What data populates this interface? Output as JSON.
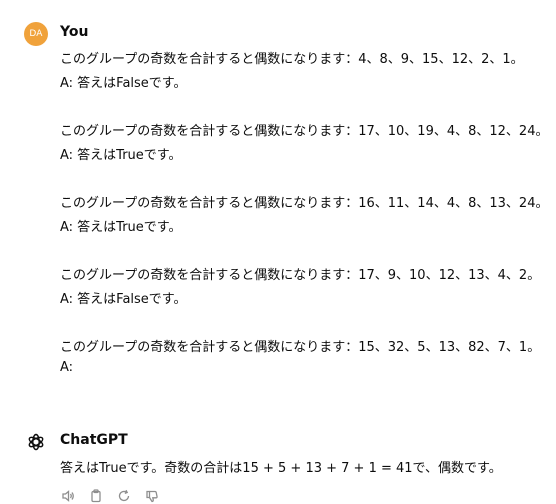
{
  "messages": [
    {
      "author": "You",
      "avatar_initials": "DA",
      "lines": [
        "このグループの奇数を合計すると偶数になります：4、8、9、15、12、2、1。",
        "A: 答えはFalseです。",
        "このグループの奇数を合計すると偶数になります：17、10、19、4、8、12、24。",
        "A: 答えはTrueです。",
        "このグループの奇数を合計すると偶数になります：16、11、14、4、8、13、24。",
        "A: 答えはTrueです。",
        "このグループの奇数を合計すると偶数になります：17、9、10、12、13、4、2。",
        "A: 答えはFalseです。",
        "このグループの奇数を合計すると偶数になります：15、32、5、13、82、7、1。",
        "A:"
      ]
    },
    {
      "author": "ChatGPT",
      "avatar_icon": "openai-logo-icon",
      "lines": [
        "答えはTrueです。奇数の合計は15 + 5 + 13 + 7 + 1 = 41で、偶数です。"
      ],
      "actions": [
        "speaker-icon",
        "clipboard-icon",
        "regenerate-icon",
        "thumbs-down-icon"
      ]
    }
  ],
  "colors": {
    "user_avatar": "#f0a23b",
    "text": "#0d0d0d",
    "icon": "#8e8e8e"
  }
}
